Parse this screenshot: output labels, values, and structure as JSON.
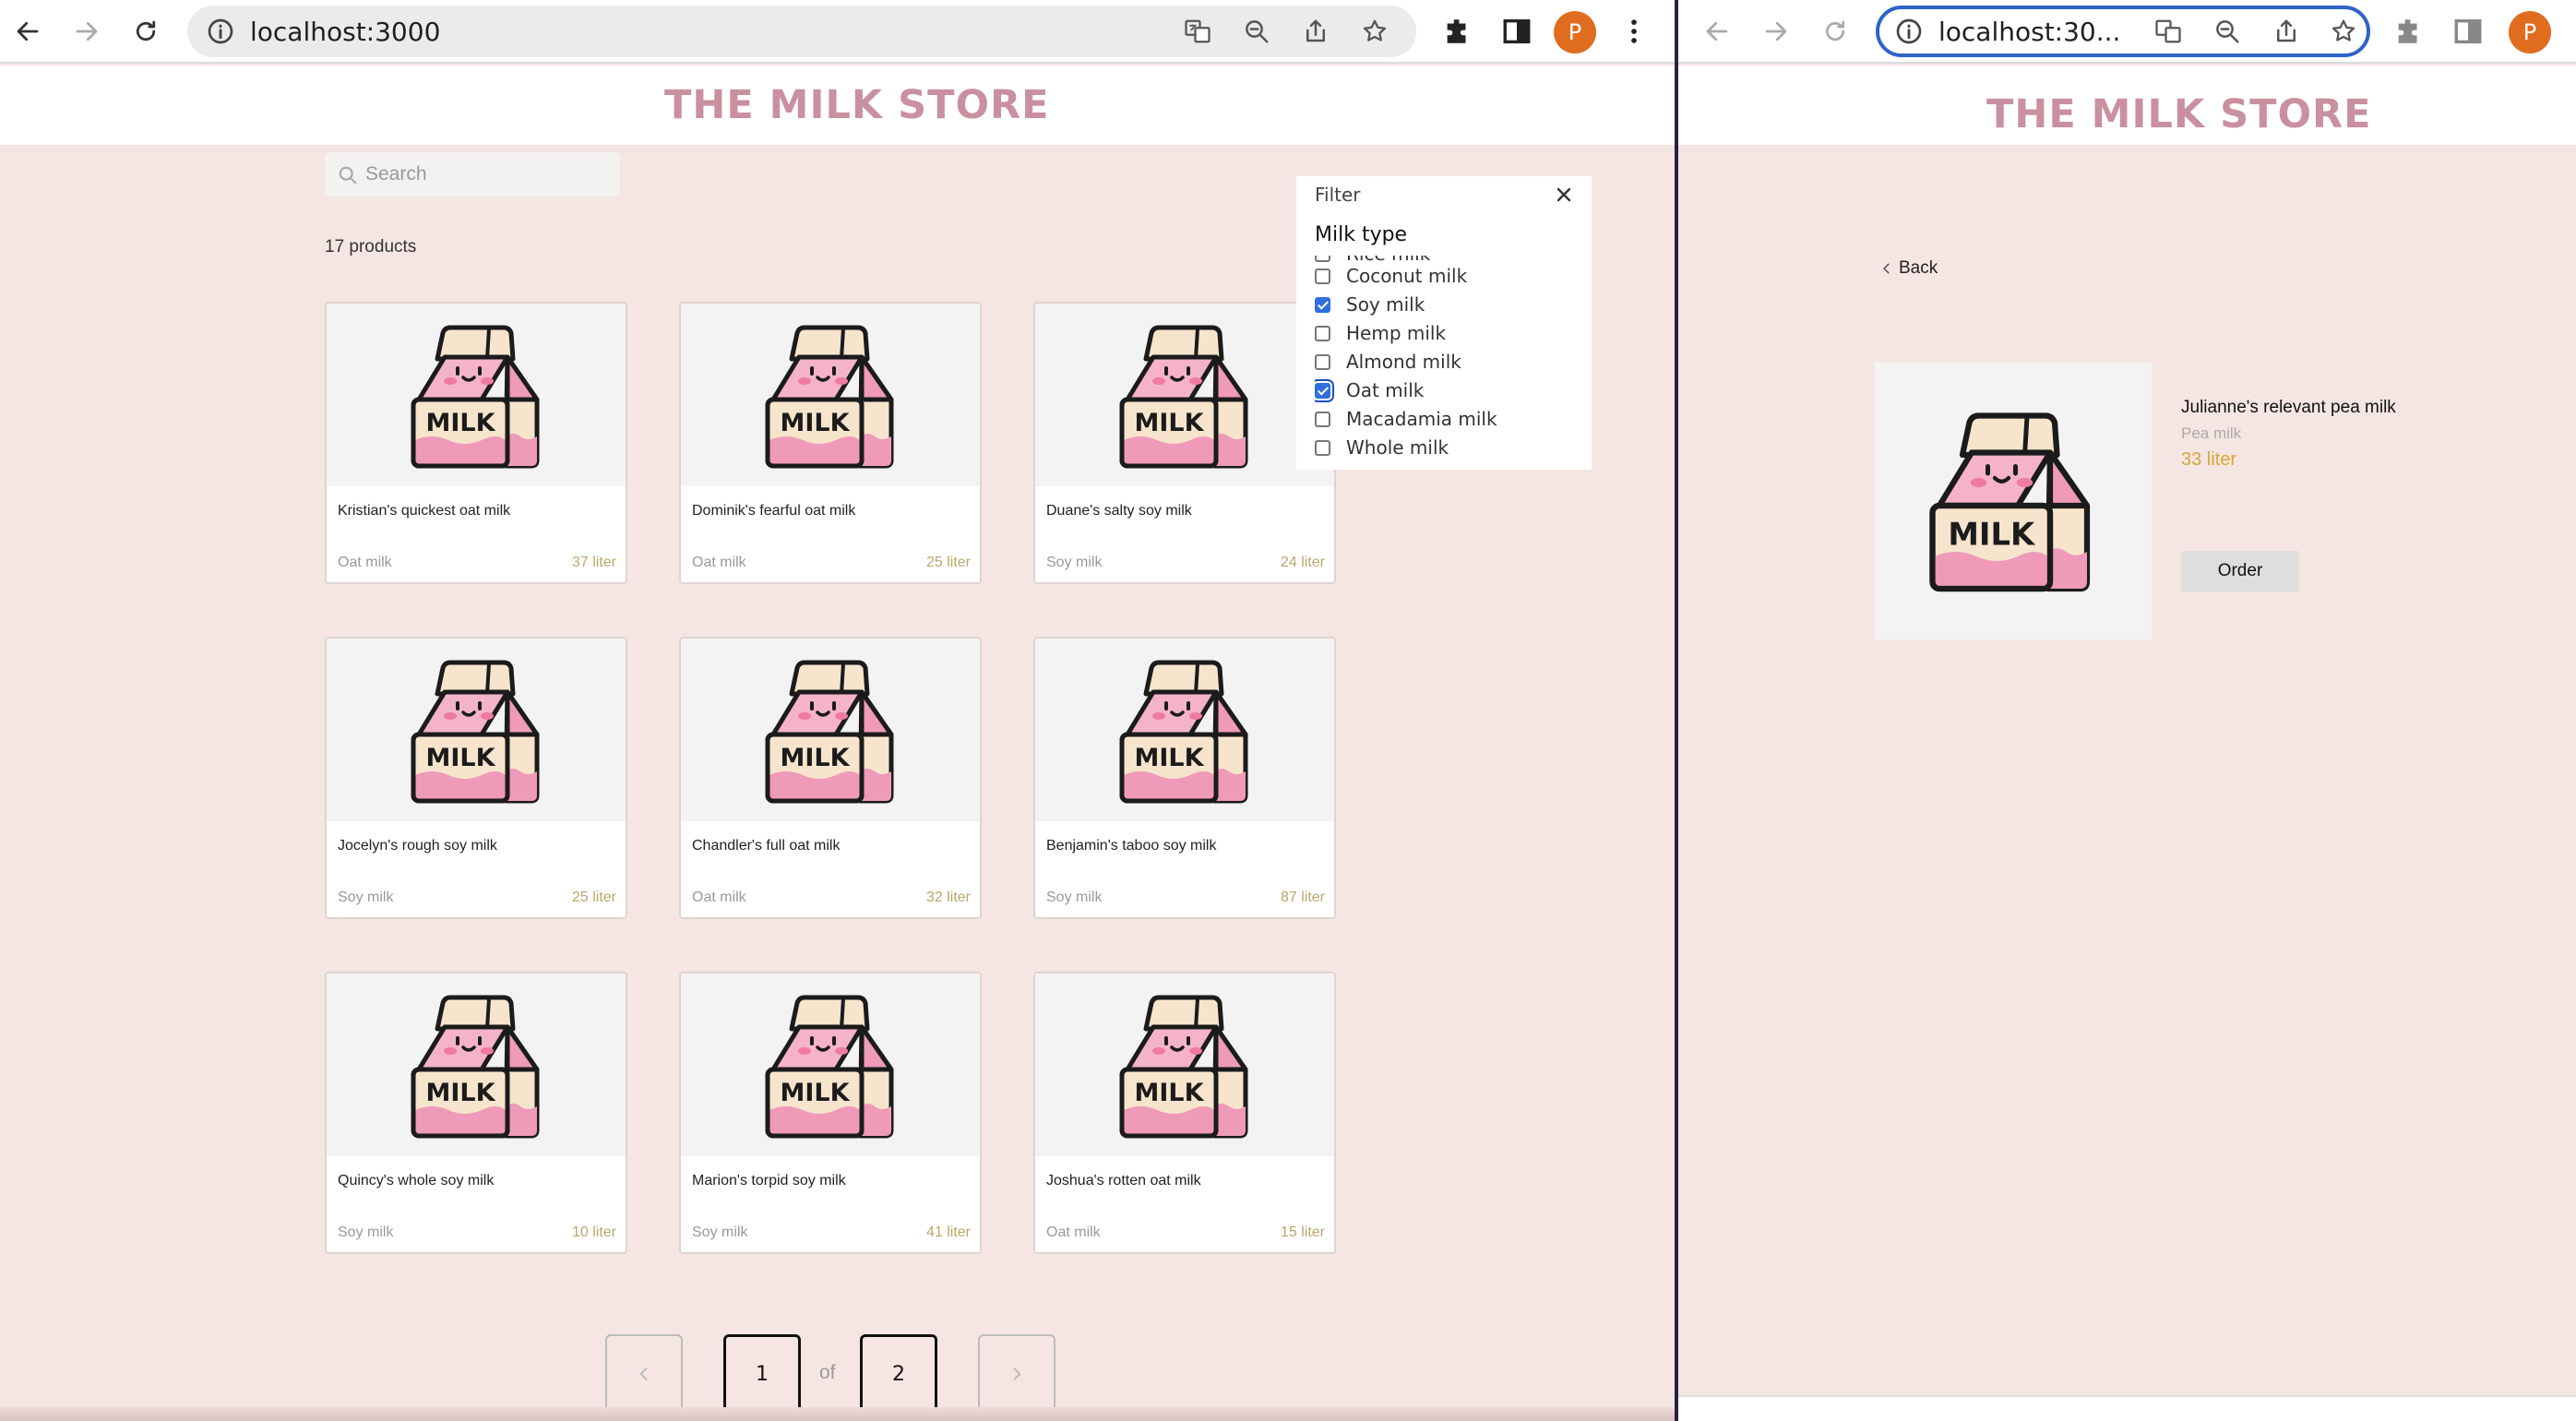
{
  "left_window": {
    "address": "localhost:3000",
    "store_title": "THE MILK STORE",
    "search": {
      "placeholder": "Search",
      "value": ""
    },
    "product_count": "17 products",
    "products": [
      {
        "name": "Kristian's quickest oat milk",
        "type": "Oat milk",
        "volume": "37 liter"
      },
      {
        "name": "Dominik's fearful oat milk",
        "type": "Oat milk",
        "volume": "25 liter"
      },
      {
        "name": "Duane's salty soy milk",
        "type": "Soy milk",
        "volume": "24 liter"
      },
      {
        "name": "Jocelyn's rough soy milk",
        "type": "Soy milk",
        "volume": "25 liter"
      },
      {
        "name": "Chandler's full oat milk",
        "type": "Oat milk",
        "volume": "32 liter"
      },
      {
        "name": "Benjamin's taboo soy milk",
        "type": "Soy milk",
        "volume": "87 liter"
      },
      {
        "name": "Quincy's whole soy milk",
        "type": "Soy milk",
        "volume": "10 liter"
      },
      {
        "name": "Marion's torpid soy milk",
        "type": "Soy milk",
        "volume": "41 liter"
      },
      {
        "name": "Joshua's rotten oat milk",
        "type": "Oat milk",
        "volume": "15 liter"
      }
    ],
    "filter": {
      "title": "Filter",
      "heading": "Milk type",
      "options": [
        {
          "label": "Rice milk",
          "checked": false
        },
        {
          "label": "Coconut milk",
          "checked": false
        },
        {
          "label": "Soy milk",
          "checked": true
        },
        {
          "label": "Hemp milk",
          "checked": false
        },
        {
          "label": "Almond milk",
          "checked": false
        },
        {
          "label": "Oat milk",
          "checked": true
        },
        {
          "label": "Macadamia milk",
          "checked": false
        },
        {
          "label": "Whole milk",
          "checked": false
        }
      ]
    },
    "pagination": {
      "current": "1",
      "of": "of",
      "total": "2"
    }
  },
  "right_window": {
    "address": "localhost:30...",
    "store_title": "THE MILK STORE",
    "back_label": "Back",
    "product": {
      "name": "Julianne's relevant pea milk",
      "type": "Pea milk",
      "volume": "33 liter"
    },
    "order_label": "Order"
  },
  "browser": {
    "avatar_letter": "P"
  },
  "colors": {
    "title": "#c9909f",
    "background": "#f5e6e3",
    "volume": "#b8a86a",
    "detail_volume": "#d9a635",
    "accent": "#2f6fe0",
    "avatar": "#e06c1f"
  },
  "icons": [
    "back-arrow-icon",
    "forward-arrow-icon",
    "reload-icon",
    "info-icon",
    "translate-icon",
    "zoom-icon",
    "share-icon",
    "star-icon",
    "extensions-icon",
    "side-panel-icon",
    "menu-icon",
    "search-icon",
    "close-icon",
    "chevron-left-icon",
    "chevron-right-icon",
    "milk-carton-icon"
  ]
}
